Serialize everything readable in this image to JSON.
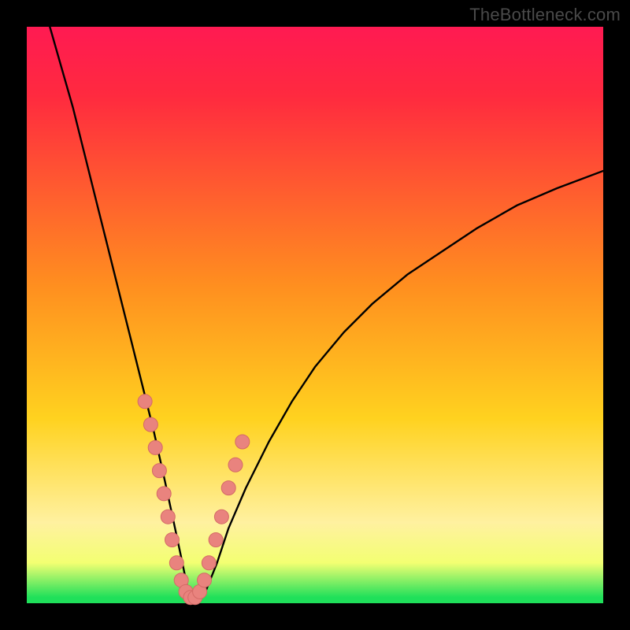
{
  "watermark": "TheBottleneck.com",
  "colors": {
    "frame": "#000000",
    "gradient": {
      "top": "#ff1a52",
      "red": "#ff2a3f",
      "orange": "#ff8f1f",
      "yellow": "#ffd21f",
      "paleyellow": "#fff1a0",
      "lemon": "#f3ff72",
      "green": "#1fe05a"
    },
    "curve": "#000000",
    "marker_fill": "#e9837e",
    "marker_stroke": "#d46a66"
  },
  "chart_data": {
    "type": "line",
    "title": "",
    "xlabel": "",
    "ylabel": "",
    "xlim": [
      0,
      100
    ],
    "ylim": [
      0,
      100
    ],
    "grid": false,
    "legend": false,
    "series": [
      {
        "name": "bottleneck-curve",
        "x": [
          4,
          6,
          8,
          10,
          12,
          14,
          16,
          18,
          20,
          22,
          24,
          25.5,
          27,
          28,
          29.5,
          31,
          33,
          35,
          38,
          42,
          46,
          50,
          55,
          60,
          66,
          72,
          78,
          85,
          92,
          100
        ],
        "y": [
          100,
          93,
          86,
          78,
          70,
          62,
          54,
          46,
          38,
          30,
          21,
          14,
          7,
          2,
          0,
          2,
          7,
          13,
          20,
          28,
          35,
          41,
          47,
          52,
          57,
          61,
          65,
          69,
          72,
          75
        ]
      }
    ],
    "markers": {
      "name": "highlighted-points",
      "x": [
        20.5,
        21.5,
        22.3,
        23.0,
        23.8,
        24.5,
        25.2,
        26.0,
        26.8,
        27.6,
        28.4,
        29.2,
        30.0,
        30.8,
        31.6,
        32.8,
        33.8,
        35.0,
        36.2,
        37.4
      ],
      "y": [
        35,
        31,
        27,
        23,
        19,
        15,
        11,
        7,
        4,
        2,
        1,
        1,
        2,
        4,
        7,
        11,
        15,
        20,
        24,
        28
      ]
    }
  }
}
